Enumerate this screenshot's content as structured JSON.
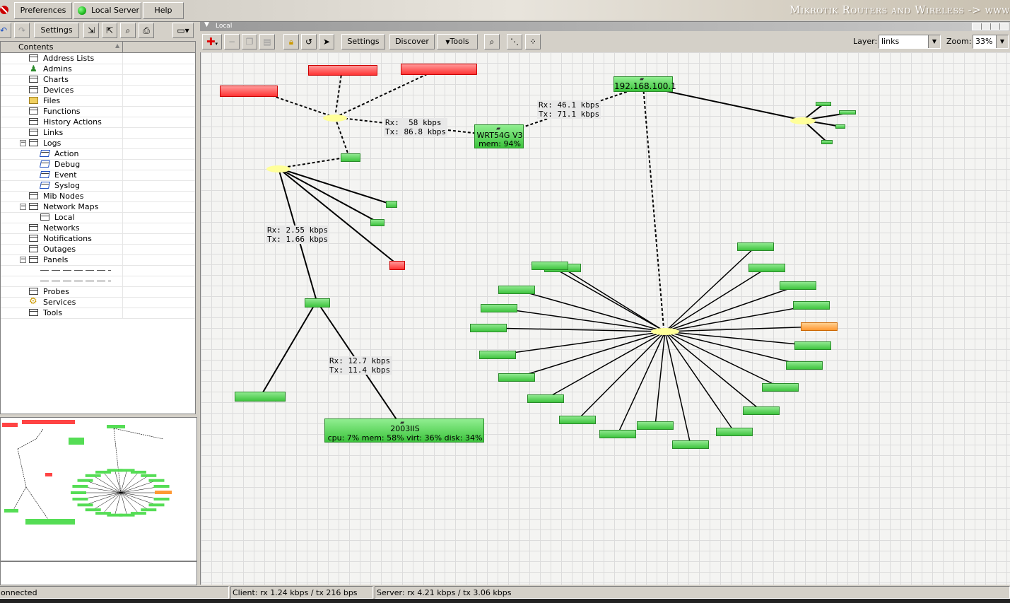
{
  "menubar": {
    "preferences": "Preferences",
    "server_status": "Local Server",
    "help": "Help",
    "brand": "Mikrotik Routers and Wireless -> www"
  },
  "toolbar_left": {
    "settings": "Settings"
  },
  "tree": {
    "header": "Contents",
    "items": [
      {
        "label": "Address Lists",
        "icon": "table-icon",
        "level": 0
      },
      {
        "label": "Admins",
        "icon": "admin-icon",
        "level": 0
      },
      {
        "label": "Charts",
        "icon": "table-icon",
        "level": 0
      },
      {
        "label": "Devices",
        "icon": "table-icon",
        "level": 0
      },
      {
        "label": "Files",
        "icon": "folder-icon",
        "level": 0
      },
      {
        "label": "Functions",
        "icon": "table-icon",
        "level": 0
      },
      {
        "label": "History Actions",
        "icon": "table-icon",
        "level": 0
      },
      {
        "label": "Links",
        "icon": "table-icon",
        "level": 0
      },
      {
        "label": "Logs",
        "icon": "table-icon",
        "level": 0,
        "toggle": "−"
      },
      {
        "label": "Action",
        "icon": "log-icon",
        "level": 1
      },
      {
        "label": "Debug",
        "icon": "log-icon",
        "level": 1
      },
      {
        "label": "Event",
        "icon": "log-icon",
        "level": 1
      },
      {
        "label": "Syslog",
        "icon": "log-icon",
        "level": 1
      },
      {
        "label": "Mib Nodes",
        "icon": "table-icon",
        "level": 0
      },
      {
        "label": "Network Maps",
        "icon": "table-icon",
        "level": 0,
        "toggle": "−"
      },
      {
        "label": "Local",
        "icon": "table-icon",
        "level": 1
      },
      {
        "label": "Networks",
        "icon": "table-icon",
        "level": 0
      },
      {
        "label": "Notifications",
        "icon": "table-icon",
        "level": 0
      },
      {
        "label": "Outages",
        "icon": "table-icon",
        "level": 0
      },
      {
        "label": "Panels",
        "icon": "table-icon",
        "level": 0,
        "toggle": "−"
      },
      {
        "label": "",
        "icon": "",
        "level": 1
      },
      {
        "label": "",
        "icon": "",
        "level": 1
      },
      {
        "label": "Probes",
        "icon": "table-icon",
        "level": 0
      },
      {
        "label": "Services",
        "icon": "gear-icon",
        "level": 0
      },
      {
        "label": "Tools",
        "icon": "table-icon",
        "level": 0
      }
    ]
  },
  "map_window": {
    "title": "Local",
    "settings": "Settings",
    "discover": "Discover",
    "tools": "Tools",
    "layer_label": "Layer:",
    "layer_value": "links",
    "zoom_label": "Zoom:",
    "zoom_value": "33%"
  },
  "map": {
    "labels": {
      "link1": "Rx:  58 kbps\nTx: 86.8 kbps",
      "link2": "Rx: 46.1 kbps\nTx: 71.1 kbps",
      "link3": "Rx: 2.55 kbps\nTx: 1.66 kbps",
      "link4": "Rx: 12.7 kbps\nTx: 11.4 kbps"
    },
    "gateway": "192.168.100.1",
    "wrt_name": "WRT54G V3",
    "wrt_mem": "mem: 94%",
    "srv_name": "2003IIS",
    "srv_stats": "cpu: 7% mem: 58% virt: 36% disk: 34%"
  },
  "statusbar": {
    "connection": "onnected",
    "client": "Client: rx 1.24 kbps / tx 216 bps",
    "server": "Server: rx 4.21 kbps / tx 3.06 kbps"
  },
  "colors": {
    "node_green": "#3fc43f",
    "node_red": "#ff3333",
    "node_orange": "#ff9933",
    "hub_yellow": "#ffff99",
    "status_green": "#22bb22"
  }
}
